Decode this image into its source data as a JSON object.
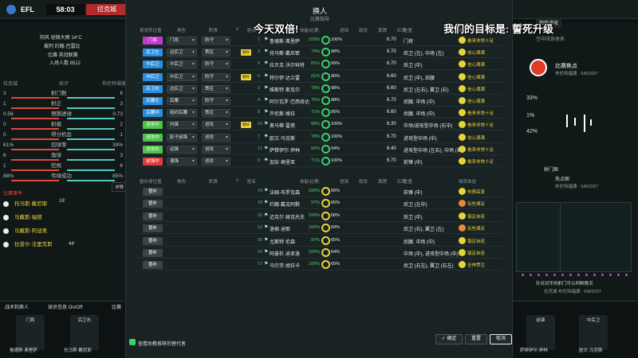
{
  "topbar": {
    "league": "EFL",
    "score": "58:03",
    "team": "拉克城"
  },
  "left": {
    "weather": "阴风 轻微大雨 14°C",
    "referee": "裁判 约翰·巴雷比",
    "competition": "比赛 英冠联赛",
    "attendance": "入场人数 8512",
    "col_left": "拉克城",
    "col_mid": "统计",
    "col_right": "布伦特福德",
    "stats": [
      {
        "l": "3",
        "label": "射门数",
        "r": "6"
      },
      {
        "l": "1",
        "label": "射正",
        "r": "3"
      },
      {
        "l": "0.58",
        "label": "预期进球",
        "r": "0.73"
      },
      {
        "l": "0",
        "label": "射偏",
        "r": "2"
      },
      {
        "l": "0",
        "label": "得分机会",
        "r": "1"
      },
      {
        "l": "61%",
        "label": "控球率",
        "r": "39%"
      },
      {
        "l": "6",
        "label": "角球",
        "r": "3"
      },
      {
        "l": "1",
        "label": "犯规",
        "r": "6"
      },
      {
        "l": "88%",
        "label": "传球成功",
        "r": "85%"
      }
    ],
    "events_title": "比赛事件",
    "events": [
      {
        "name": "托马斯·戴尼耶"
      },
      {
        "name": "马戴斯·福德"
      },
      {
        "name": "马戴斯·阿迪奥"
      },
      {
        "name": "拉普尔·法里克斯"
      }
    ],
    "event_minutes": [
      "16'",
      "44'"
    ],
    "more": "详情"
  },
  "right": {
    "tab": "积极进攻",
    "sub": "空中压迫体系",
    "team": "比赛焦点",
    "subtitle": "布伦特福德 · 5/8/2027",
    "percentages": [
      "33%",
      "1%",
      "42%"
    ],
    "section": "射门图",
    "heat": "热点图",
    "heat_sub": "布伦特福德 · 5/8/2027",
    "legend": "针对对手的射门可以判断情况",
    "legend2": "拉克城 布伦特福德 · 5/8/2027"
  },
  "modal": {
    "title": "换人",
    "subtitle": "比赛指导",
    "headers": {
      "pos": "首发阵位置",
      "role": "角色",
      "duty": "职责",
      "num": "#",
      "name": "姓名",
      "cond": "体能/比赛..",
      "g1": "进球",
      "g2": "助攻",
      "g3": "黄牌",
      "g4": "红牌",
      "rating": "评分",
      "position": "位置",
      "happy": "球员体验"
    },
    "headers2": {
      "pos": "替补席位置",
      "role": "角色",
      "duty": "职责",
      "num": "#",
      "name": "姓名",
      "cond": "体能/比赛..",
      "g1": "进球",
      "g2": "助攻",
      "g3": "黄牌",
      "g4": "红牌",
      "rating": "评分",
      "position": "位置",
      "happy": "球员体验"
    },
    "starters": [
      {
        "pos": "门将",
        "role": "门将",
        "duty": "防守",
        "num": "1",
        "name": "鲁德斯·弗里萨",
        "cond": "100%",
        "pct": "100%",
        "rating": "6.70",
        "position": "门将",
        "happy": "看来非常十足",
        "tag": "",
        "color": "#c03ad0"
      },
      {
        "pos": "后卫左",
        "role": "边后卫",
        "duty": "策应",
        "num": "3",
        "name": "托马斯·戴尼耶",
        "cond": "74%",
        "pct": "98%",
        "rating": "6.70",
        "position": "后卫 (左), 中场 (左)",
        "happy": "信心满满",
        "tag": "替补",
        "color": "#2a8ee0"
      },
      {
        "pos": "中后卫",
        "role": "中后卫",
        "duty": "防守",
        "num": "5",
        "name": "拉贝克·沃尔科特",
        "cond": "81%",
        "pct": "99%",
        "rating": "6.70",
        "position": "后卫 (中)",
        "happy": "信心满满",
        "tag": "",
        "color": "#2a8ee0"
      },
      {
        "pos": "中后卫",
        "role": "中后卫",
        "duty": "防守",
        "num": "6",
        "name": "特尔伊·达兰雷",
        "cond": "81%",
        "pct": "96%",
        "rating": "6.60",
        "position": "后卫 (中), 后腰",
        "happy": "信心满满",
        "tag": "替补",
        "color": "#2a8ee0"
      },
      {
        "pos": "后卫右",
        "role": "边后卫",
        "duty": "策应",
        "num": "2",
        "name": "维斯特·斯克尔",
        "cond": "79%",
        "pct": "98%",
        "rating": "6.60",
        "position": "后卫 (左右), 翼卫 (右)",
        "happy": "信心满满",
        "tag": "",
        "color": "#2a8ee0"
      },
      {
        "pos": "后腰左",
        "role": "后腰",
        "duty": "防守",
        "num": "4",
        "name": "阿尔瓦罗·巴西奇达",
        "cond": "76%",
        "pct": "98%",
        "rating": "6.70",
        "position": "后腰, 中场 (中)",
        "happy": "信心满满",
        "tag": "",
        "color": "#2a8ee0"
      },
      {
        "pos": "后腰中",
        "role": "组织后腰",
        "duty": "策应",
        "num": "8",
        "name": "齐伦斯·格拉",
        "cond": "71%",
        "pct": "95%",
        "rating": "6.60",
        "position": "后腰, 中场 (中)",
        "happy": "看来非常十足",
        "tag": "",
        "color": "#2a8ee0"
      },
      {
        "pos": "进攻中",
        "role": "内锋",
        "duty": "进攻",
        "num": "10",
        "name": "奥马蒂·雷塔",
        "cond": "80%",
        "pct": "100%",
        "rating": "6.30",
        "position": "中场/进攻型中场 (右中)",
        "happy": "看来非常十足",
        "tag": "替补",
        "color": "#4ec24a"
      },
      {
        "pos": "进攻中",
        "role": "影子前锋",
        "duty": "进攻",
        "num": "7",
        "name": "欧文·马克斯",
        "cond": "78%",
        "pct": "100%",
        "rating": "6.70",
        "position": "进攻型中场 (中)",
        "happy": "信心满满",
        "tag": "",
        "color": "#4ec24a"
      },
      {
        "pos": "进攻右",
        "role": "边锋",
        "duty": "进攻",
        "num": "11",
        "name": "萨穆伊尔·伊林",
        "cond": "66%",
        "pct": "94%",
        "rating": "6.40",
        "position": "进攻型中场 (左右), 中场 (右)",
        "happy": "看来非常十足",
        "tag": "",
        "color": "#4ec24a"
      },
      {
        "pos": "前锋中",
        "role": "速锋",
        "duty": "进攻",
        "num": "9",
        "name": "加安·佩里亚",
        "cond": "71%",
        "pct": "100%",
        "rating": "6.70",
        "position": "前锋 (中)",
        "happy": "看来非常十足",
        "tag": "",
        "color": "#e03a3a"
      }
    ],
    "subs": [
      {
        "pos": "替补",
        "num": "14",
        "name": "法姆·布罗克森",
        "cond": "100%",
        "pct": "66%",
        "position": "前锋 (中)",
        "happy": "热情高涨"
      },
      {
        "pos": "替补",
        "num": "18",
        "name": "约翰·戴克阿默",
        "cond": "97%",
        "pct": "65%",
        "position": "后卫 (左中)",
        "happy": "有些满足"
      },
      {
        "pos": "替补",
        "num": "16",
        "name": "迈克尔·赫克托夫",
        "cond": "100%",
        "pct": "68%",
        "position": "后卫 (中)",
        "happy": "镇定自若"
      },
      {
        "pos": "替补",
        "num": "12",
        "name": "洛根·迪耶",
        "cond": "100%",
        "pct": "69%",
        "position": "后卫 (右), 翼卫 (左)",
        "happy": "有些满足"
      },
      {
        "pos": "替补",
        "num": "20",
        "name": "尤斯特·伦森",
        "cond": "97%",
        "pct": "65%",
        "position": "后腰, 中场 (中)",
        "happy": "镇定自若"
      },
      {
        "pos": "替补",
        "num": "15",
        "name": "阿曼杜·迪亚洛",
        "cond": "100%",
        "pct": "64%",
        "position": "中场 (中), 进攻型中场 (中)",
        "happy": "镇定自若"
      },
      {
        "pos": "替补",
        "num": "17",
        "name": "马尔茨·胡拉卡",
        "cond": "100%",
        "pct": "65%",
        "position": "后卫 (右左), 翼卫 (右左)",
        "happy": "全神贯注"
      }
    ],
    "footer_note": "查看助教推荐的替代者",
    "confirm": "确定",
    "reset": "重置",
    "cancel": "取消"
  },
  "overlay": {
    "left": "今天双倍!",
    "right": "我们的目标是: 誓死升级"
  },
  "bottom": {
    "tabs": [
      "战术和换人",
      "球员信息 On/Off",
      "比赛"
    ],
    "players": [
      {
        "role": "门将",
        "name": "鲁德斯·弗里萨"
      },
      {
        "role": "后卫右",
        "name": "托马斯·戴尼耶"
      },
      {
        "role": "前锋",
        "name": "萨穆伊尔·伊林"
      },
      {
        "role": "中后卫",
        "name": "欧文·马克斯"
      }
    ]
  },
  "colors": {
    "accent": "#3bd16a",
    "happy": "#e6d43a",
    "gk": "#c03ad0",
    "def": "#2a8ee0",
    "mid": "#4ec24a",
    "fwd": "#e03a3a"
  }
}
